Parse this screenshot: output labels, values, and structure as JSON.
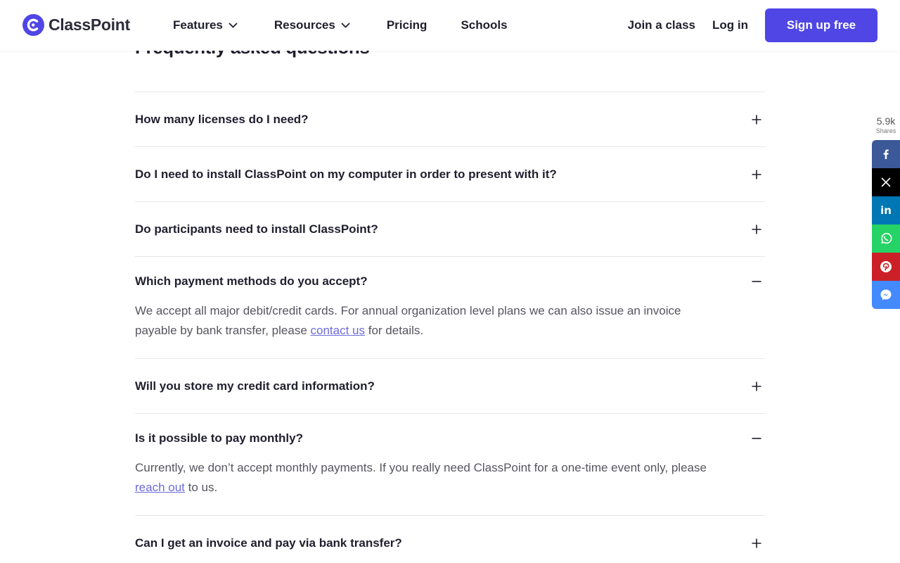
{
  "header": {
    "logo_text": "ClassPoint",
    "nav": {
      "features": "Features",
      "resources": "Resources",
      "pricing": "Pricing",
      "schools": "Schools"
    },
    "join_class": "Join a class",
    "log_in": "Log in",
    "sign_up": "Sign up free"
  },
  "faq": {
    "title": "Frequently asked questions",
    "items": [
      {
        "question": "How many licenses do I need?",
        "expanded": false
      },
      {
        "question": "Do I need to install ClassPoint on my computer in order to present with it?",
        "expanded": false
      },
      {
        "question": "Do participants need to install ClassPoint?",
        "expanded": false
      },
      {
        "question": "Which payment methods do you accept?",
        "expanded": true,
        "answer_before": "We accept all major debit/credit cards. For annual organization level plans we can also issue an invoice payable by bank transfer, please ",
        "answer_link": "contact us",
        "answer_after": " for details."
      },
      {
        "question": "Will you store my credit card information?",
        "expanded": false
      },
      {
        "question": "Is it possible to pay monthly?",
        "expanded": true,
        "answer_before": "Currently, we don’t accept monthly payments. If you really need ClassPoint for a one-time event only, please ",
        "answer_link": "reach out",
        "answer_after": " to us."
      },
      {
        "question": "Can I get an invoice and pay via bank transfer?",
        "expanded": false
      }
    ]
  },
  "share": {
    "count": "5.9k",
    "label": "Shares",
    "buttons": [
      "facebook-icon",
      "x-icon",
      "linkedin-icon",
      "whatsapp-icon",
      "pinterest-icon",
      "messenger-icon"
    ]
  },
  "colors": {
    "brand": "#4f46e5",
    "link": "#6b6bdc",
    "facebook": "#3b5998",
    "x": "#000000",
    "linkedin": "#0077b5",
    "whatsapp": "#25d366",
    "pinterest": "#cb2027",
    "messenger": "#448aff"
  }
}
